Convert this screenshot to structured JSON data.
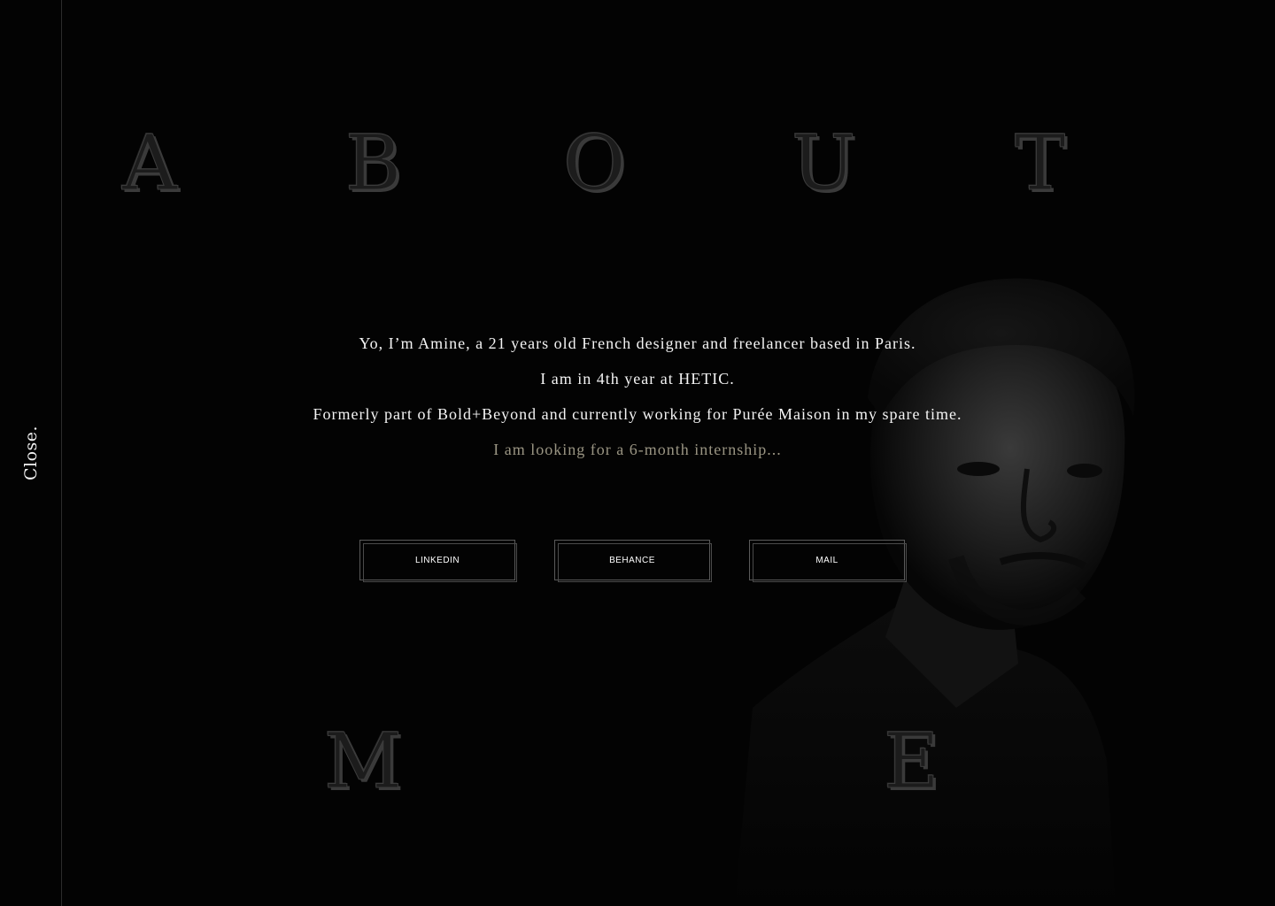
{
  "sidebar": {
    "close_label": "Close."
  },
  "heading": {
    "top_letters": [
      "A",
      "B",
      "O",
      "U",
      "T"
    ],
    "bottom_letters": [
      "M",
      "E"
    ]
  },
  "intro": {
    "line1": "Yo, I’m Amine, a 21 years old French designer and freelancer based in Paris.",
    "line2": "I am in 4th year at HETIC.",
    "line3": "Formerly part of Bold+Beyond and currently working for Purée Maison in my spare time.",
    "line4": "I am looking for a 6-month internship..."
  },
  "links": {
    "linkedin": "LINKEDIN",
    "behance": "BEHANCE",
    "mail": "MAIL"
  },
  "colors": {
    "background": "#030303",
    "text": "#f4f4f4",
    "accent": "#9a9583",
    "outline": "#5a5a5a"
  }
}
